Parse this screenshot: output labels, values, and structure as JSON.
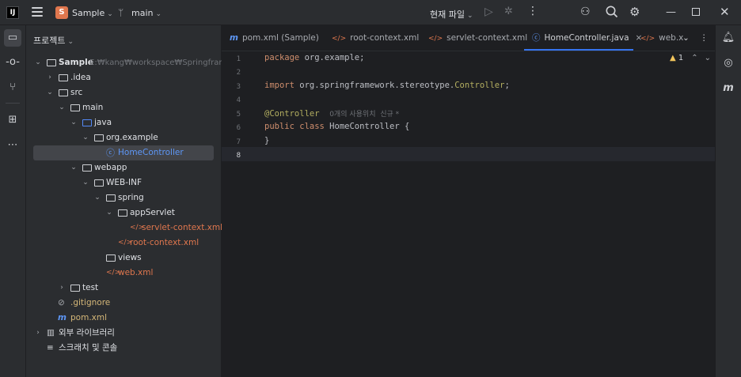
{
  "titlebar": {
    "logo": "IJ",
    "project_chip": "S",
    "project_name": "Sample",
    "branch": "main",
    "run_config": "현재 파일"
  },
  "project_panel": {
    "title": "프로젝트",
    "tree": [
      {
        "label": "Sample",
        "suffix": "E:₩kang₩workspace₩Springframework",
        "depth": 0,
        "arrow": "down",
        "icon": "module-folder-icon"
      },
      {
        "label": ".idea",
        "depth": 1,
        "arrow": "right",
        "icon": "folder-icon"
      },
      {
        "label": "src",
        "depth": 1,
        "arrow": "down",
        "icon": "folder-icon"
      },
      {
        "label": "main",
        "depth": 2,
        "arrow": "down",
        "icon": "folder-icon"
      },
      {
        "label": "java",
        "depth": 3,
        "arrow": "down",
        "icon": "source-folder-icon"
      },
      {
        "label": "org.example",
        "depth": 4,
        "arrow": "down",
        "icon": "package-icon"
      },
      {
        "label": "HomeController",
        "depth": 5,
        "arrow": "",
        "icon": "class-icon",
        "selected": true
      },
      {
        "label": "webapp",
        "depth": 3,
        "arrow": "down",
        "icon": "folder-icon"
      },
      {
        "label": "WEB-INF",
        "depth": 4,
        "arrow": "down",
        "icon": "folder-icon"
      },
      {
        "label": "spring",
        "depth": 5,
        "arrow": "down",
        "icon": "folder-icon"
      },
      {
        "label": "appServlet",
        "depth": 6,
        "arrow": "down",
        "icon": "folder-icon"
      },
      {
        "label": "servlet-context.xml",
        "depth": 7,
        "arrow": "",
        "icon": "xml-icon"
      },
      {
        "label": "root-context.xml",
        "depth": 6,
        "arrow": "",
        "icon": "xml-icon"
      },
      {
        "label": "views",
        "depth": 5,
        "arrow": "",
        "icon": "folder-icon"
      },
      {
        "label": "web.xml",
        "depth": 5,
        "arrow": "",
        "icon": "xml-icon"
      },
      {
        "label": "test",
        "depth": 2,
        "arrow": "right",
        "icon": "folder-icon"
      },
      {
        "label": ".gitignore",
        "depth": 1,
        "arrow": "",
        "icon": "ignore-icon"
      },
      {
        "label": "pom.xml",
        "depth": 1,
        "arrow": "",
        "icon": "maven-icon"
      },
      {
        "label": "외부 라이브러리",
        "depth": 0,
        "arrow": "right",
        "icon": "library-icon"
      },
      {
        "label": "스크래치 및 콘솔",
        "depth": 0,
        "arrow": "",
        "icon": "scratch-icon"
      }
    ]
  },
  "editor": {
    "tabs": [
      {
        "label": "pom.xml (Sample)",
        "icon": "m"
      },
      {
        "label": "root-context.xml",
        "icon": "</>"
      },
      {
        "label": "servlet-context.xml",
        "icon": "</>"
      },
      {
        "label": "HomeController.java",
        "icon": "©",
        "active": true
      },
      {
        "label": "web.x",
        "icon": "</>"
      }
    ],
    "line_numbers": [
      "1",
      "2",
      "3",
      "4",
      "5",
      "6",
      "7",
      "8"
    ],
    "line1_kw": "package",
    "line1_rest": " org.example;",
    "line3_kw": "import",
    "line3_pkg": " org.springframework.stereotype.",
    "line3_cls": "Controller",
    "line3_end": ";",
    "line5_ann": "@Controller",
    "line5_hint": "0개의 사용위치  신규 *",
    "line6_kw": "public class",
    "line6_rest": " HomeController {",
    "line7": "}",
    "inspection_count": "1"
  }
}
